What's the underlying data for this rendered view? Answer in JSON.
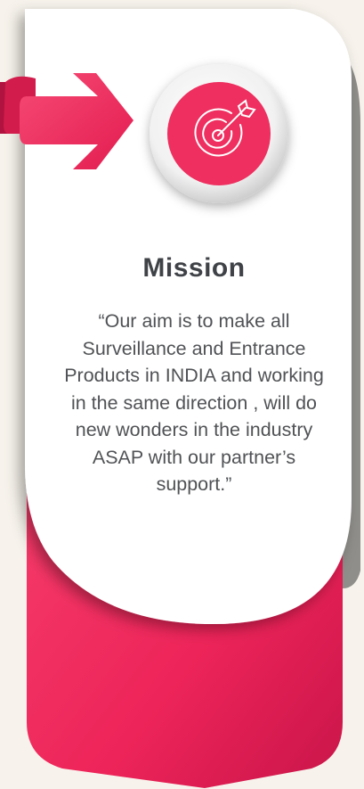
{
  "card": {
    "title": "Mission",
    "icon": "target-arrow-icon",
    "accent_color": "#ee2f5f",
    "quote_lines": [
      "“Our aim is to make all",
      " Surveillance and Entrance",
      "Products in INDIA and working",
      "in the same direction , will do",
      "new wonders  in the industry",
      "ASAP with our partner’s",
      "support.”"
    ]
  }
}
